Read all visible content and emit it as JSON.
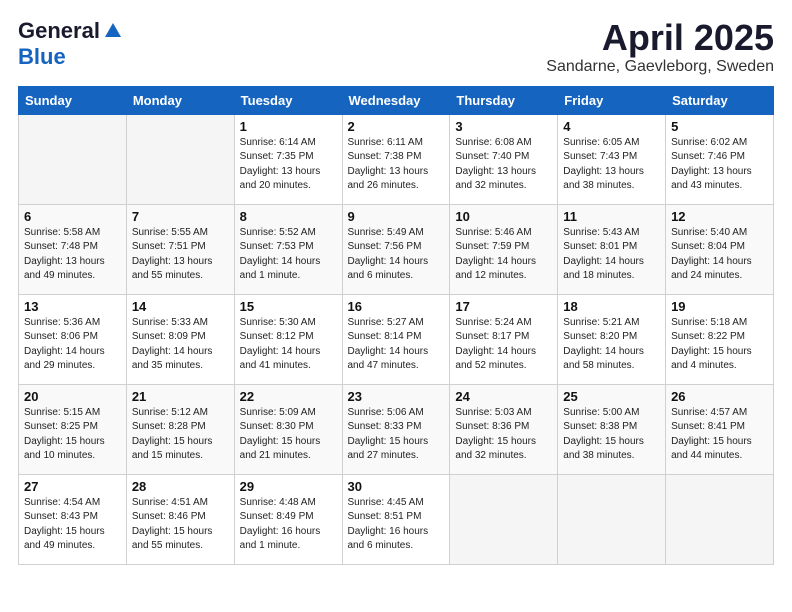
{
  "header": {
    "logo_general": "General",
    "logo_blue": "Blue",
    "month_title": "April 2025",
    "location": "Sandarne, Gaevleborg, Sweden"
  },
  "weekdays": [
    "Sunday",
    "Monday",
    "Tuesday",
    "Wednesday",
    "Thursday",
    "Friday",
    "Saturday"
  ],
  "weeks": [
    [
      {
        "day": "",
        "info": ""
      },
      {
        "day": "",
        "info": ""
      },
      {
        "day": "1",
        "info": "Sunrise: 6:14 AM\nSunset: 7:35 PM\nDaylight: 13 hours\nand 20 minutes."
      },
      {
        "day": "2",
        "info": "Sunrise: 6:11 AM\nSunset: 7:38 PM\nDaylight: 13 hours\nand 26 minutes."
      },
      {
        "day": "3",
        "info": "Sunrise: 6:08 AM\nSunset: 7:40 PM\nDaylight: 13 hours\nand 32 minutes."
      },
      {
        "day": "4",
        "info": "Sunrise: 6:05 AM\nSunset: 7:43 PM\nDaylight: 13 hours\nand 38 minutes."
      },
      {
        "day": "5",
        "info": "Sunrise: 6:02 AM\nSunset: 7:46 PM\nDaylight: 13 hours\nand 43 minutes."
      }
    ],
    [
      {
        "day": "6",
        "info": "Sunrise: 5:58 AM\nSunset: 7:48 PM\nDaylight: 13 hours\nand 49 minutes."
      },
      {
        "day": "7",
        "info": "Sunrise: 5:55 AM\nSunset: 7:51 PM\nDaylight: 13 hours\nand 55 minutes."
      },
      {
        "day": "8",
        "info": "Sunrise: 5:52 AM\nSunset: 7:53 PM\nDaylight: 14 hours\nand 1 minute."
      },
      {
        "day": "9",
        "info": "Sunrise: 5:49 AM\nSunset: 7:56 PM\nDaylight: 14 hours\nand 6 minutes."
      },
      {
        "day": "10",
        "info": "Sunrise: 5:46 AM\nSunset: 7:59 PM\nDaylight: 14 hours\nand 12 minutes."
      },
      {
        "day": "11",
        "info": "Sunrise: 5:43 AM\nSunset: 8:01 PM\nDaylight: 14 hours\nand 18 minutes."
      },
      {
        "day": "12",
        "info": "Sunrise: 5:40 AM\nSunset: 8:04 PM\nDaylight: 14 hours\nand 24 minutes."
      }
    ],
    [
      {
        "day": "13",
        "info": "Sunrise: 5:36 AM\nSunset: 8:06 PM\nDaylight: 14 hours\nand 29 minutes."
      },
      {
        "day": "14",
        "info": "Sunrise: 5:33 AM\nSunset: 8:09 PM\nDaylight: 14 hours\nand 35 minutes."
      },
      {
        "day": "15",
        "info": "Sunrise: 5:30 AM\nSunset: 8:12 PM\nDaylight: 14 hours\nand 41 minutes."
      },
      {
        "day": "16",
        "info": "Sunrise: 5:27 AM\nSunset: 8:14 PM\nDaylight: 14 hours\nand 47 minutes."
      },
      {
        "day": "17",
        "info": "Sunrise: 5:24 AM\nSunset: 8:17 PM\nDaylight: 14 hours\nand 52 minutes."
      },
      {
        "day": "18",
        "info": "Sunrise: 5:21 AM\nSunset: 8:20 PM\nDaylight: 14 hours\nand 58 minutes."
      },
      {
        "day": "19",
        "info": "Sunrise: 5:18 AM\nSunset: 8:22 PM\nDaylight: 15 hours\nand 4 minutes."
      }
    ],
    [
      {
        "day": "20",
        "info": "Sunrise: 5:15 AM\nSunset: 8:25 PM\nDaylight: 15 hours\nand 10 minutes."
      },
      {
        "day": "21",
        "info": "Sunrise: 5:12 AM\nSunset: 8:28 PM\nDaylight: 15 hours\nand 15 minutes."
      },
      {
        "day": "22",
        "info": "Sunrise: 5:09 AM\nSunset: 8:30 PM\nDaylight: 15 hours\nand 21 minutes."
      },
      {
        "day": "23",
        "info": "Sunrise: 5:06 AM\nSunset: 8:33 PM\nDaylight: 15 hours\nand 27 minutes."
      },
      {
        "day": "24",
        "info": "Sunrise: 5:03 AM\nSunset: 8:36 PM\nDaylight: 15 hours\nand 32 minutes."
      },
      {
        "day": "25",
        "info": "Sunrise: 5:00 AM\nSunset: 8:38 PM\nDaylight: 15 hours\nand 38 minutes."
      },
      {
        "day": "26",
        "info": "Sunrise: 4:57 AM\nSunset: 8:41 PM\nDaylight: 15 hours\nand 44 minutes."
      }
    ],
    [
      {
        "day": "27",
        "info": "Sunrise: 4:54 AM\nSunset: 8:43 PM\nDaylight: 15 hours\nand 49 minutes."
      },
      {
        "day": "28",
        "info": "Sunrise: 4:51 AM\nSunset: 8:46 PM\nDaylight: 15 hours\nand 55 minutes."
      },
      {
        "day": "29",
        "info": "Sunrise: 4:48 AM\nSunset: 8:49 PM\nDaylight: 16 hours\nand 1 minute."
      },
      {
        "day": "30",
        "info": "Sunrise: 4:45 AM\nSunset: 8:51 PM\nDaylight: 16 hours\nand 6 minutes."
      },
      {
        "day": "",
        "info": ""
      },
      {
        "day": "",
        "info": ""
      },
      {
        "day": "",
        "info": ""
      }
    ]
  ]
}
